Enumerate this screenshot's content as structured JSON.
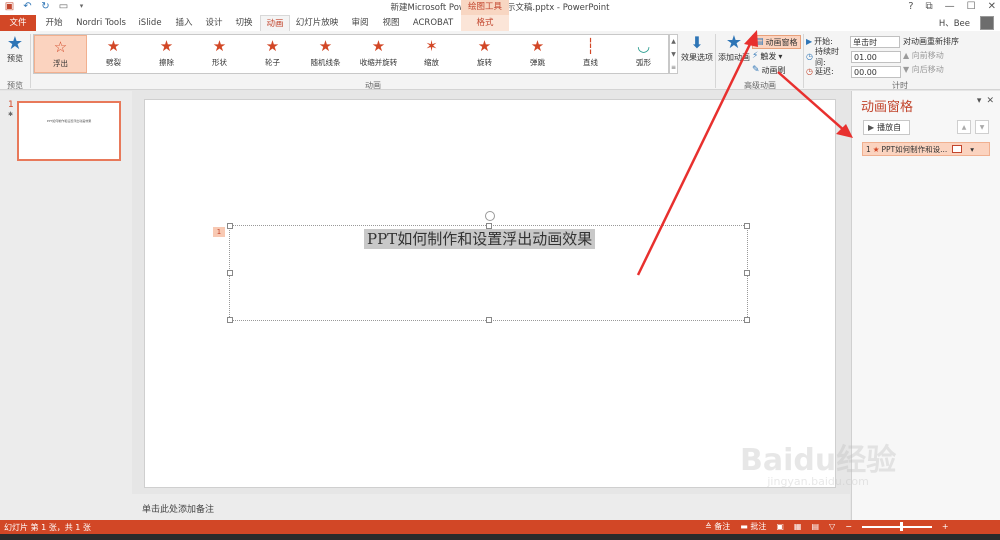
{
  "app": {
    "document_title": "新建Microsoft PowerPoint 演示文稿.pptx - PowerPoint",
    "contextual_group": "绘图工具",
    "user": "H、Bee",
    "window_controls": [
      "?",
      "⧉",
      "—",
      "☐",
      "✕"
    ]
  },
  "quick_access": [
    "save-icon",
    "undo-icon",
    "redo-icon",
    "present-icon",
    "dropdown-icon"
  ],
  "tabs": [
    {
      "label": "文件",
      "kind": "file"
    },
    {
      "label": "开始"
    },
    {
      "label": "Nordri Tools"
    },
    {
      "label": "iSlide"
    },
    {
      "label": "插入"
    },
    {
      "label": "设计"
    },
    {
      "label": "切换"
    },
    {
      "label": "动画",
      "kind": "active"
    },
    {
      "label": "幻灯片放映"
    },
    {
      "label": "审阅"
    },
    {
      "label": "视图"
    },
    {
      "label": "ACROBAT"
    },
    {
      "label": "格式",
      "kind": "format"
    }
  ],
  "ribbon": {
    "preview": {
      "label": "预览",
      "group": "预览"
    },
    "animation_group": "动画",
    "animations": [
      {
        "label": "浮出",
        "icon": "☆",
        "selected": true
      },
      {
        "label": "劈裂",
        "icon": "★"
      },
      {
        "label": "擦除",
        "icon": "★"
      },
      {
        "label": "形状",
        "icon": "★"
      },
      {
        "label": "轮子",
        "icon": "★"
      },
      {
        "label": "随机线条",
        "icon": "★"
      },
      {
        "label": "收缩并旋转",
        "icon": "★"
      },
      {
        "label": "缩放",
        "icon": "✶"
      },
      {
        "label": "旋转",
        "icon": "★"
      },
      {
        "label": "弹跳",
        "icon": "★"
      },
      {
        "label": "直线",
        "icon": "┆"
      },
      {
        "label": "弧形",
        "icon": "◡"
      }
    ],
    "effect_options": "效果选项",
    "add_animation": "添加动画",
    "advanced_group": "高级动画",
    "animation_pane_btn": "动画窗格",
    "trigger": "触发",
    "animation_painter": "动画刷",
    "timing_group": "计时",
    "start_label": "开始:",
    "start_value": "单击时",
    "duration_label": "持续时间:",
    "duration_value": "01.00",
    "delay_label": "延迟:",
    "delay_value": "00.00",
    "reorder_title": "对动画重新排序",
    "move_earlier": "向前移动",
    "move_later": "向后移动"
  },
  "slides_pane": {
    "slide_number": "1",
    "thumbnail_text": "PPT如何制作和设置浮出动画效果"
  },
  "slide": {
    "animation_tag": "1",
    "title": "PPT如何制作和设置浮出动画效果"
  },
  "notes_placeholder": "单击此处添加备注",
  "animation_pane": {
    "title": "动画窗格",
    "play_button": "播放自",
    "item_number": "1",
    "item_label": "PPT如何制作和设..."
  },
  "status": {
    "slide_info": "幻灯片 第 1 张，共 1 张",
    "notes_button": "备注",
    "comments_button": "批注"
  },
  "watermark": {
    "brand": "Baidu经验",
    "url": "jingyan.baidu.com"
  },
  "colors": {
    "accent": "#d24726",
    "highlight": "#fbd3bf",
    "arrow": "#e8302e"
  }
}
